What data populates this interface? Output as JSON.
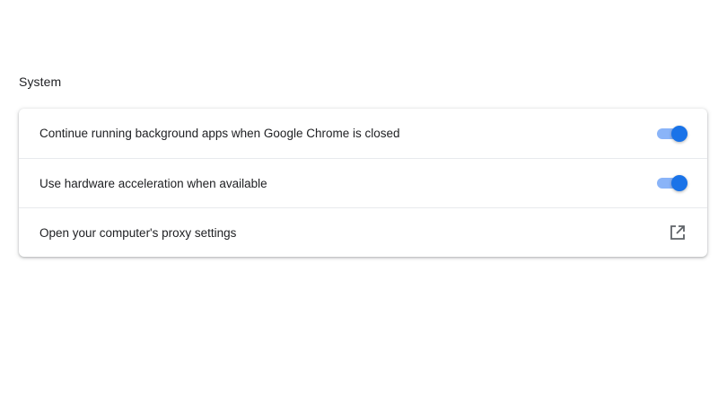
{
  "section": {
    "title": "System"
  },
  "settings": {
    "items": [
      {
        "label": "Continue running background apps when Google Chrome is closed",
        "control": "toggle",
        "checked": true
      },
      {
        "label": "Use hardware acceleration when available",
        "control": "toggle",
        "checked": true
      },
      {
        "label": "Open your computer's proxy settings",
        "control": "external-link",
        "icon": "open-in-new-icon"
      }
    ]
  },
  "colors": {
    "toggle_on_track": "#8ab4f8",
    "toggle_on_knob": "#1a73e8",
    "icon": "#5f6368",
    "text": "#202124"
  }
}
